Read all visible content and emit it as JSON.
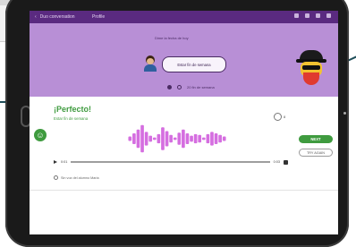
{
  "app": {
    "header_left": "Duo conversation",
    "header_title": "Profile",
    "prompt_label": "Dime la fecha de hoy",
    "bubble_text": "Estar fin de semana",
    "progress_label": "20 fin de semana"
  },
  "feedback": {
    "title": "¡Perfecto!",
    "subtitle": "Estar fin de semana",
    "score": "8",
    "time_start": "0:01",
    "time_end": "0:03",
    "next_label": "NEXT",
    "retry_label": "TRY AGAIN",
    "hint": "Sin voz del alumno Maria"
  },
  "waveform": {
    "color": "#d56ee0",
    "levels": [
      0.15,
      0.35,
      0.6,
      0.9,
      0.45,
      0.2,
      0.08,
      0.3,
      0.75,
      0.5,
      0.25,
      0.08,
      0.4,
      0.6,
      0.35,
      0.2,
      0.3,
      0.25,
      0.08,
      0.3,
      0.45,
      0.35,
      0.25,
      0.15
    ]
  },
  "colors": {
    "header": "#5a2a80",
    "lesson_bg": "#b88fd6",
    "success": "#3f9b3f",
    "accent_line": "#1f4e59"
  }
}
